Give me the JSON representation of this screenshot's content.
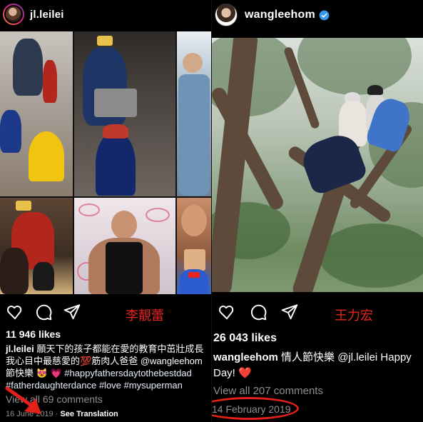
{
  "left_post": {
    "username": "jl.leilei",
    "name_annotation": "李靚蕾",
    "likes": "11 946 likes",
    "caption_user": "jl.leilei",
    "caption_line1": " 願天下的孩子都能在愛的教育中茁壯成長",
    "caption_line2": "我心目中最慈愛的",
    "caption_emoji_inline": "💯",
    "caption_line2b": "筋肉人爸爸 @wangleehom",
    "caption_line3a": "節快樂 ",
    "caption_emoji_cat": "😻",
    "caption_emoji_heart": "💗",
    "caption_line3b": " #happyfathersdaytothebestdad",
    "caption_line4": "#fatherdaughterdance #love #mysuperman",
    "comments": "View all 69 comments",
    "date": "16 June 2019",
    "separator": " · ",
    "see_translation": "See Translation"
  },
  "right_post": {
    "username": "wangleehom",
    "name_annotation": "王力宏",
    "likes": "26 043 likes",
    "caption_user": "wangleehom",
    "caption_line1": " 情人節快樂 @jl.leilei Happy",
    "caption_line2": "Day! ",
    "caption_emoji_heart": "❤️",
    "comments": "View all 207 comments",
    "date": "14 February 2019"
  },
  "icons": {
    "like": "heart-icon",
    "comment": "comment-icon",
    "share": "send-icon",
    "verified": "verified-badge-icon"
  },
  "colors": {
    "annotation_red": "#e4201a",
    "verified_blue": "#3897f0",
    "muted_text": "#8e8e8e"
  }
}
